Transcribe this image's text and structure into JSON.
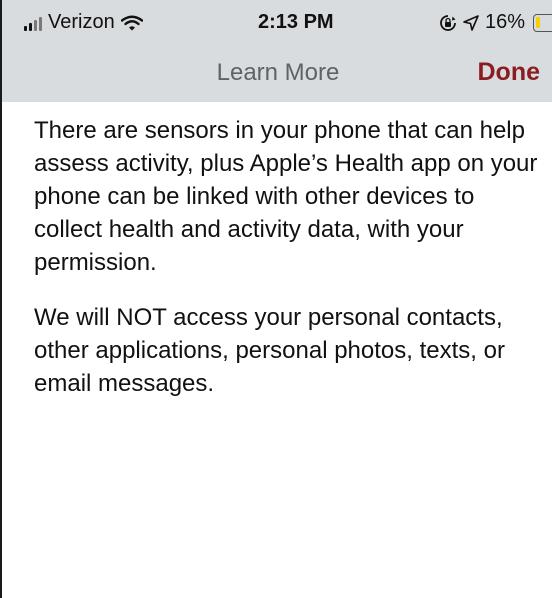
{
  "status_bar": {
    "carrier": "Verizon",
    "time": "2:13 PM",
    "battery_text": "16%",
    "battery_level": 0.16,
    "icons": [
      "signal-icon",
      "wifi-icon",
      "orientation-lock-icon",
      "location-icon",
      "battery-icon"
    ]
  },
  "nav": {
    "title": "Learn More",
    "done_label": "Done"
  },
  "body": {
    "paragraphs": [
      "There are sensors in your phone that can help assess activity, plus Apple’s Health app on your phone can be linked with other devices to collect health and activity data, with your permission.",
      "We will NOT access your personal contacts, other applications, personal photos, texts, or email messages."
    ]
  },
  "colors": {
    "header_background": "#d8dcdf",
    "done_accent": "#8b1d22",
    "title_gray": "#5f6266",
    "battery_low": "#f5d000"
  }
}
